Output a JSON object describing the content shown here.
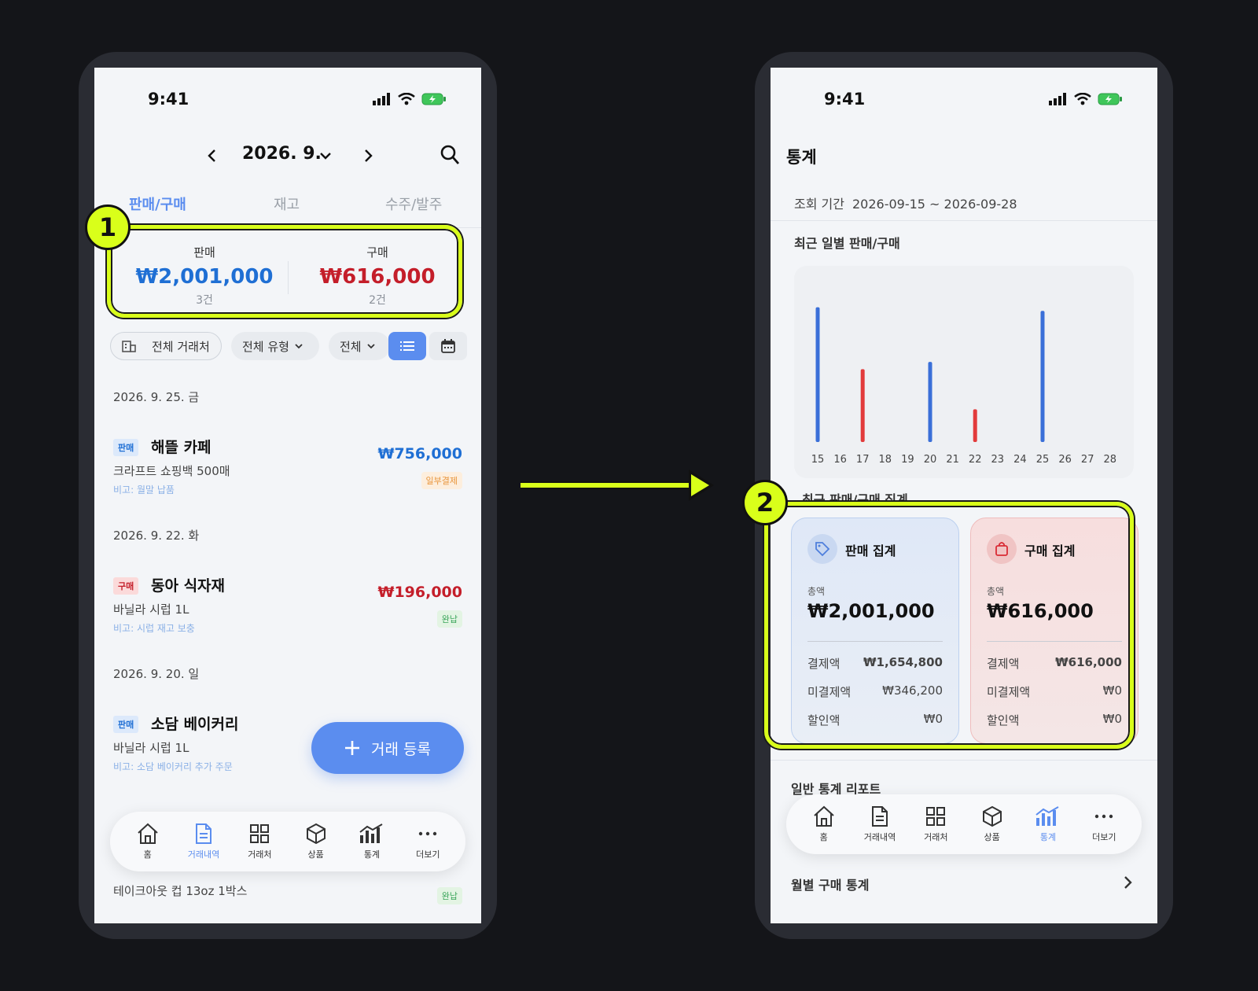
{
  "status": {
    "time": "9:41"
  },
  "left": {
    "month": "2026. 9.",
    "tabs": [
      "판매/구매",
      "재고",
      "수주/발주"
    ],
    "summary": {
      "sale_label": "판매",
      "sale_amount": "₩2,001,000",
      "sale_count": "3건",
      "buy_label": "구매",
      "buy_amount": "₩616,000",
      "buy_count": "2건"
    },
    "filters": {
      "partner": "전체 거래처",
      "type": "전체 유형",
      "status": "전체"
    },
    "groups": [
      {
        "date": "2026. 9. 25. 금",
        "tx": {
          "badge": "판매",
          "name": "해뜰 카페",
          "item": "크라프트 쇼핑백 500매",
          "note": "비고: 월말 납품",
          "amount": "₩756,000",
          "state": "일부결제"
        }
      },
      {
        "date": "2026. 9. 22. 화",
        "tx": {
          "badge": "구매",
          "name": "동아 식자재",
          "item": "바닐라 시럽 1L",
          "note": "비고: 시럽 재고 보충",
          "amount": "₩196,000",
          "state": "완납"
        }
      },
      {
        "date": "2026. 9. 20. 일",
        "tx": {
          "badge": "판매",
          "name": "소담 베이커리",
          "item": "바닐라 시럽 1L",
          "note": "비고: 소담 베이커리 추가 주문"
        }
      }
    ],
    "partial_row": {
      "item": "테이크아웃 컵 13oz 1박스",
      "state": "완납"
    },
    "fab_label": "거래 등록",
    "marker": "1"
  },
  "right": {
    "title": "통계",
    "period_label": "조회 기간",
    "period_value": "2026-09-15 ~ 2026-09-28",
    "chart_title": "최근 일별 판매/구매",
    "agg_title": "최근 판매/구매 집계",
    "sale_card": {
      "title": "판매 집계",
      "total_label": "총액",
      "total": "₩2,001,000",
      "rows": [
        {
          "label": "결제액",
          "value": "₩1,654,800"
        },
        {
          "label": "미결제액",
          "value": "₩346,200"
        },
        {
          "label": "할인액",
          "value": "₩0"
        }
      ]
    },
    "buy_card": {
      "title": "구매 집계",
      "total_label": "총액",
      "total": "₩616,000",
      "rows": [
        {
          "label": "결제액",
          "value": "₩616,000"
        },
        {
          "label": "미결제액",
          "value": "₩0"
        },
        {
          "label": "할인액",
          "value": "₩0"
        }
      ]
    },
    "report_title": "일반 통계 리포트",
    "monthly_label": "월별 구매 통계",
    "marker": "2"
  },
  "tabbar": {
    "items": [
      {
        "label": "홈",
        "icon": "home-icon"
      },
      {
        "label": "거래내역",
        "icon": "document-icon"
      },
      {
        "label": "거래처",
        "icon": "grid-icon"
      },
      {
        "label": "상품",
        "icon": "cube-icon"
      },
      {
        "label": "통계",
        "icon": "bar-chart-icon"
      },
      {
        "label": "더보기",
        "icon": "more-icon"
      }
    ]
  },
  "chart_data": {
    "type": "bar",
    "categories": [
      "15",
      "16",
      "17",
      "18",
      "19",
      "20",
      "21",
      "22",
      "23",
      "24",
      "25",
      "26",
      "27",
      "28"
    ],
    "series": [
      {
        "color": "#3a6fd8",
        "values": [
          740000,
          0,
          0,
          0,
          0,
          440000,
          0,
          0,
          0,
          0,
          720000,
          0,
          0,
          0
        ]
      },
      {
        "color": "#e23b3b",
        "values": [
          0,
          0,
          400000,
          0,
          0,
          0,
          0,
          180000,
          0,
          0,
          0,
          0,
          0,
          0
        ]
      }
    ],
    "grid": false
  }
}
